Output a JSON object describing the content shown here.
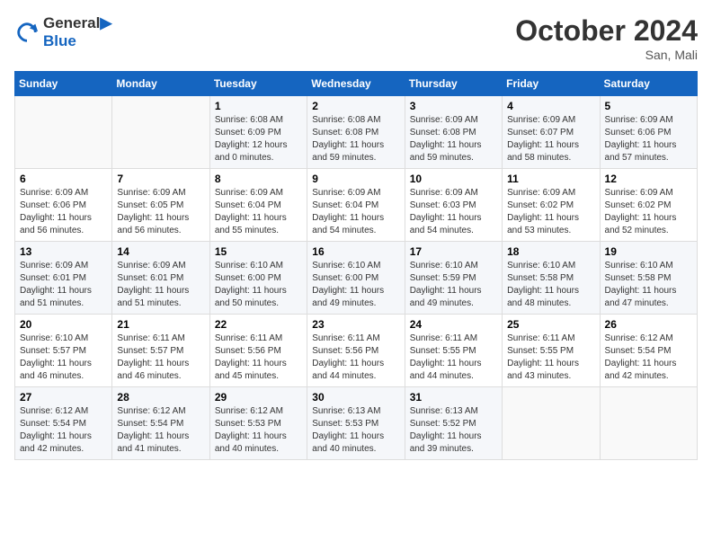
{
  "header": {
    "logo_line1": "General",
    "logo_line2": "Blue",
    "month_title": "October 2024",
    "location": "San, Mali"
  },
  "weekdays": [
    "Sunday",
    "Monday",
    "Tuesday",
    "Wednesday",
    "Thursday",
    "Friday",
    "Saturday"
  ],
  "weeks": [
    [
      {
        "day": "",
        "info": ""
      },
      {
        "day": "",
        "info": ""
      },
      {
        "day": "1",
        "info": "Sunrise: 6:08 AM\nSunset: 6:09 PM\nDaylight: 12 hours\nand 0 minutes."
      },
      {
        "day": "2",
        "info": "Sunrise: 6:08 AM\nSunset: 6:08 PM\nDaylight: 11 hours\nand 59 minutes."
      },
      {
        "day": "3",
        "info": "Sunrise: 6:09 AM\nSunset: 6:08 PM\nDaylight: 11 hours\nand 59 minutes."
      },
      {
        "day": "4",
        "info": "Sunrise: 6:09 AM\nSunset: 6:07 PM\nDaylight: 11 hours\nand 58 minutes."
      },
      {
        "day": "5",
        "info": "Sunrise: 6:09 AM\nSunset: 6:06 PM\nDaylight: 11 hours\nand 57 minutes."
      }
    ],
    [
      {
        "day": "6",
        "info": "Sunrise: 6:09 AM\nSunset: 6:06 PM\nDaylight: 11 hours\nand 56 minutes."
      },
      {
        "day": "7",
        "info": "Sunrise: 6:09 AM\nSunset: 6:05 PM\nDaylight: 11 hours\nand 56 minutes."
      },
      {
        "day": "8",
        "info": "Sunrise: 6:09 AM\nSunset: 6:04 PM\nDaylight: 11 hours\nand 55 minutes."
      },
      {
        "day": "9",
        "info": "Sunrise: 6:09 AM\nSunset: 6:04 PM\nDaylight: 11 hours\nand 54 minutes."
      },
      {
        "day": "10",
        "info": "Sunrise: 6:09 AM\nSunset: 6:03 PM\nDaylight: 11 hours\nand 54 minutes."
      },
      {
        "day": "11",
        "info": "Sunrise: 6:09 AM\nSunset: 6:02 PM\nDaylight: 11 hours\nand 53 minutes."
      },
      {
        "day": "12",
        "info": "Sunrise: 6:09 AM\nSunset: 6:02 PM\nDaylight: 11 hours\nand 52 minutes."
      }
    ],
    [
      {
        "day": "13",
        "info": "Sunrise: 6:09 AM\nSunset: 6:01 PM\nDaylight: 11 hours\nand 51 minutes."
      },
      {
        "day": "14",
        "info": "Sunrise: 6:09 AM\nSunset: 6:01 PM\nDaylight: 11 hours\nand 51 minutes."
      },
      {
        "day": "15",
        "info": "Sunrise: 6:10 AM\nSunset: 6:00 PM\nDaylight: 11 hours\nand 50 minutes."
      },
      {
        "day": "16",
        "info": "Sunrise: 6:10 AM\nSunset: 6:00 PM\nDaylight: 11 hours\nand 49 minutes."
      },
      {
        "day": "17",
        "info": "Sunrise: 6:10 AM\nSunset: 5:59 PM\nDaylight: 11 hours\nand 49 minutes."
      },
      {
        "day": "18",
        "info": "Sunrise: 6:10 AM\nSunset: 5:58 PM\nDaylight: 11 hours\nand 48 minutes."
      },
      {
        "day": "19",
        "info": "Sunrise: 6:10 AM\nSunset: 5:58 PM\nDaylight: 11 hours\nand 47 minutes."
      }
    ],
    [
      {
        "day": "20",
        "info": "Sunrise: 6:10 AM\nSunset: 5:57 PM\nDaylight: 11 hours\nand 46 minutes."
      },
      {
        "day": "21",
        "info": "Sunrise: 6:11 AM\nSunset: 5:57 PM\nDaylight: 11 hours\nand 46 minutes."
      },
      {
        "day": "22",
        "info": "Sunrise: 6:11 AM\nSunset: 5:56 PM\nDaylight: 11 hours\nand 45 minutes."
      },
      {
        "day": "23",
        "info": "Sunrise: 6:11 AM\nSunset: 5:56 PM\nDaylight: 11 hours\nand 44 minutes."
      },
      {
        "day": "24",
        "info": "Sunrise: 6:11 AM\nSunset: 5:55 PM\nDaylight: 11 hours\nand 44 minutes."
      },
      {
        "day": "25",
        "info": "Sunrise: 6:11 AM\nSunset: 5:55 PM\nDaylight: 11 hours\nand 43 minutes."
      },
      {
        "day": "26",
        "info": "Sunrise: 6:12 AM\nSunset: 5:54 PM\nDaylight: 11 hours\nand 42 minutes."
      }
    ],
    [
      {
        "day": "27",
        "info": "Sunrise: 6:12 AM\nSunset: 5:54 PM\nDaylight: 11 hours\nand 42 minutes."
      },
      {
        "day": "28",
        "info": "Sunrise: 6:12 AM\nSunset: 5:54 PM\nDaylight: 11 hours\nand 41 minutes."
      },
      {
        "day": "29",
        "info": "Sunrise: 6:12 AM\nSunset: 5:53 PM\nDaylight: 11 hours\nand 40 minutes."
      },
      {
        "day": "30",
        "info": "Sunrise: 6:13 AM\nSunset: 5:53 PM\nDaylight: 11 hours\nand 40 minutes."
      },
      {
        "day": "31",
        "info": "Sunrise: 6:13 AM\nSunset: 5:52 PM\nDaylight: 11 hours\nand 39 minutes."
      },
      {
        "day": "",
        "info": ""
      },
      {
        "day": "",
        "info": ""
      }
    ]
  ]
}
